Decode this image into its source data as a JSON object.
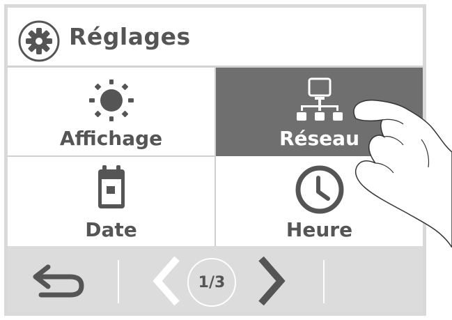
{
  "header": {
    "title": "Réglages",
    "icon": "gear-icon"
  },
  "tiles": [
    {
      "label": "Affichage",
      "icon": "sun-icon",
      "active": false
    },
    {
      "label": "Réseau",
      "icon": "network-icon",
      "active": true
    },
    {
      "label": "Date",
      "icon": "calendar-icon",
      "active": false
    },
    {
      "label": "Heure",
      "icon": "clock-icon",
      "active": false
    }
  ],
  "footer": {
    "back_icon": "back-arrow-icon",
    "prev_icon": "chevron-left-icon",
    "next_icon": "chevron-right-icon",
    "page_indicator": "1/3"
  },
  "colors": {
    "text": "#555555",
    "active_tile": "#6f6f6f",
    "border": "#d9d9d9",
    "footer_bg": "#dcdcdc",
    "disabled_chevron": "#ffffff"
  }
}
